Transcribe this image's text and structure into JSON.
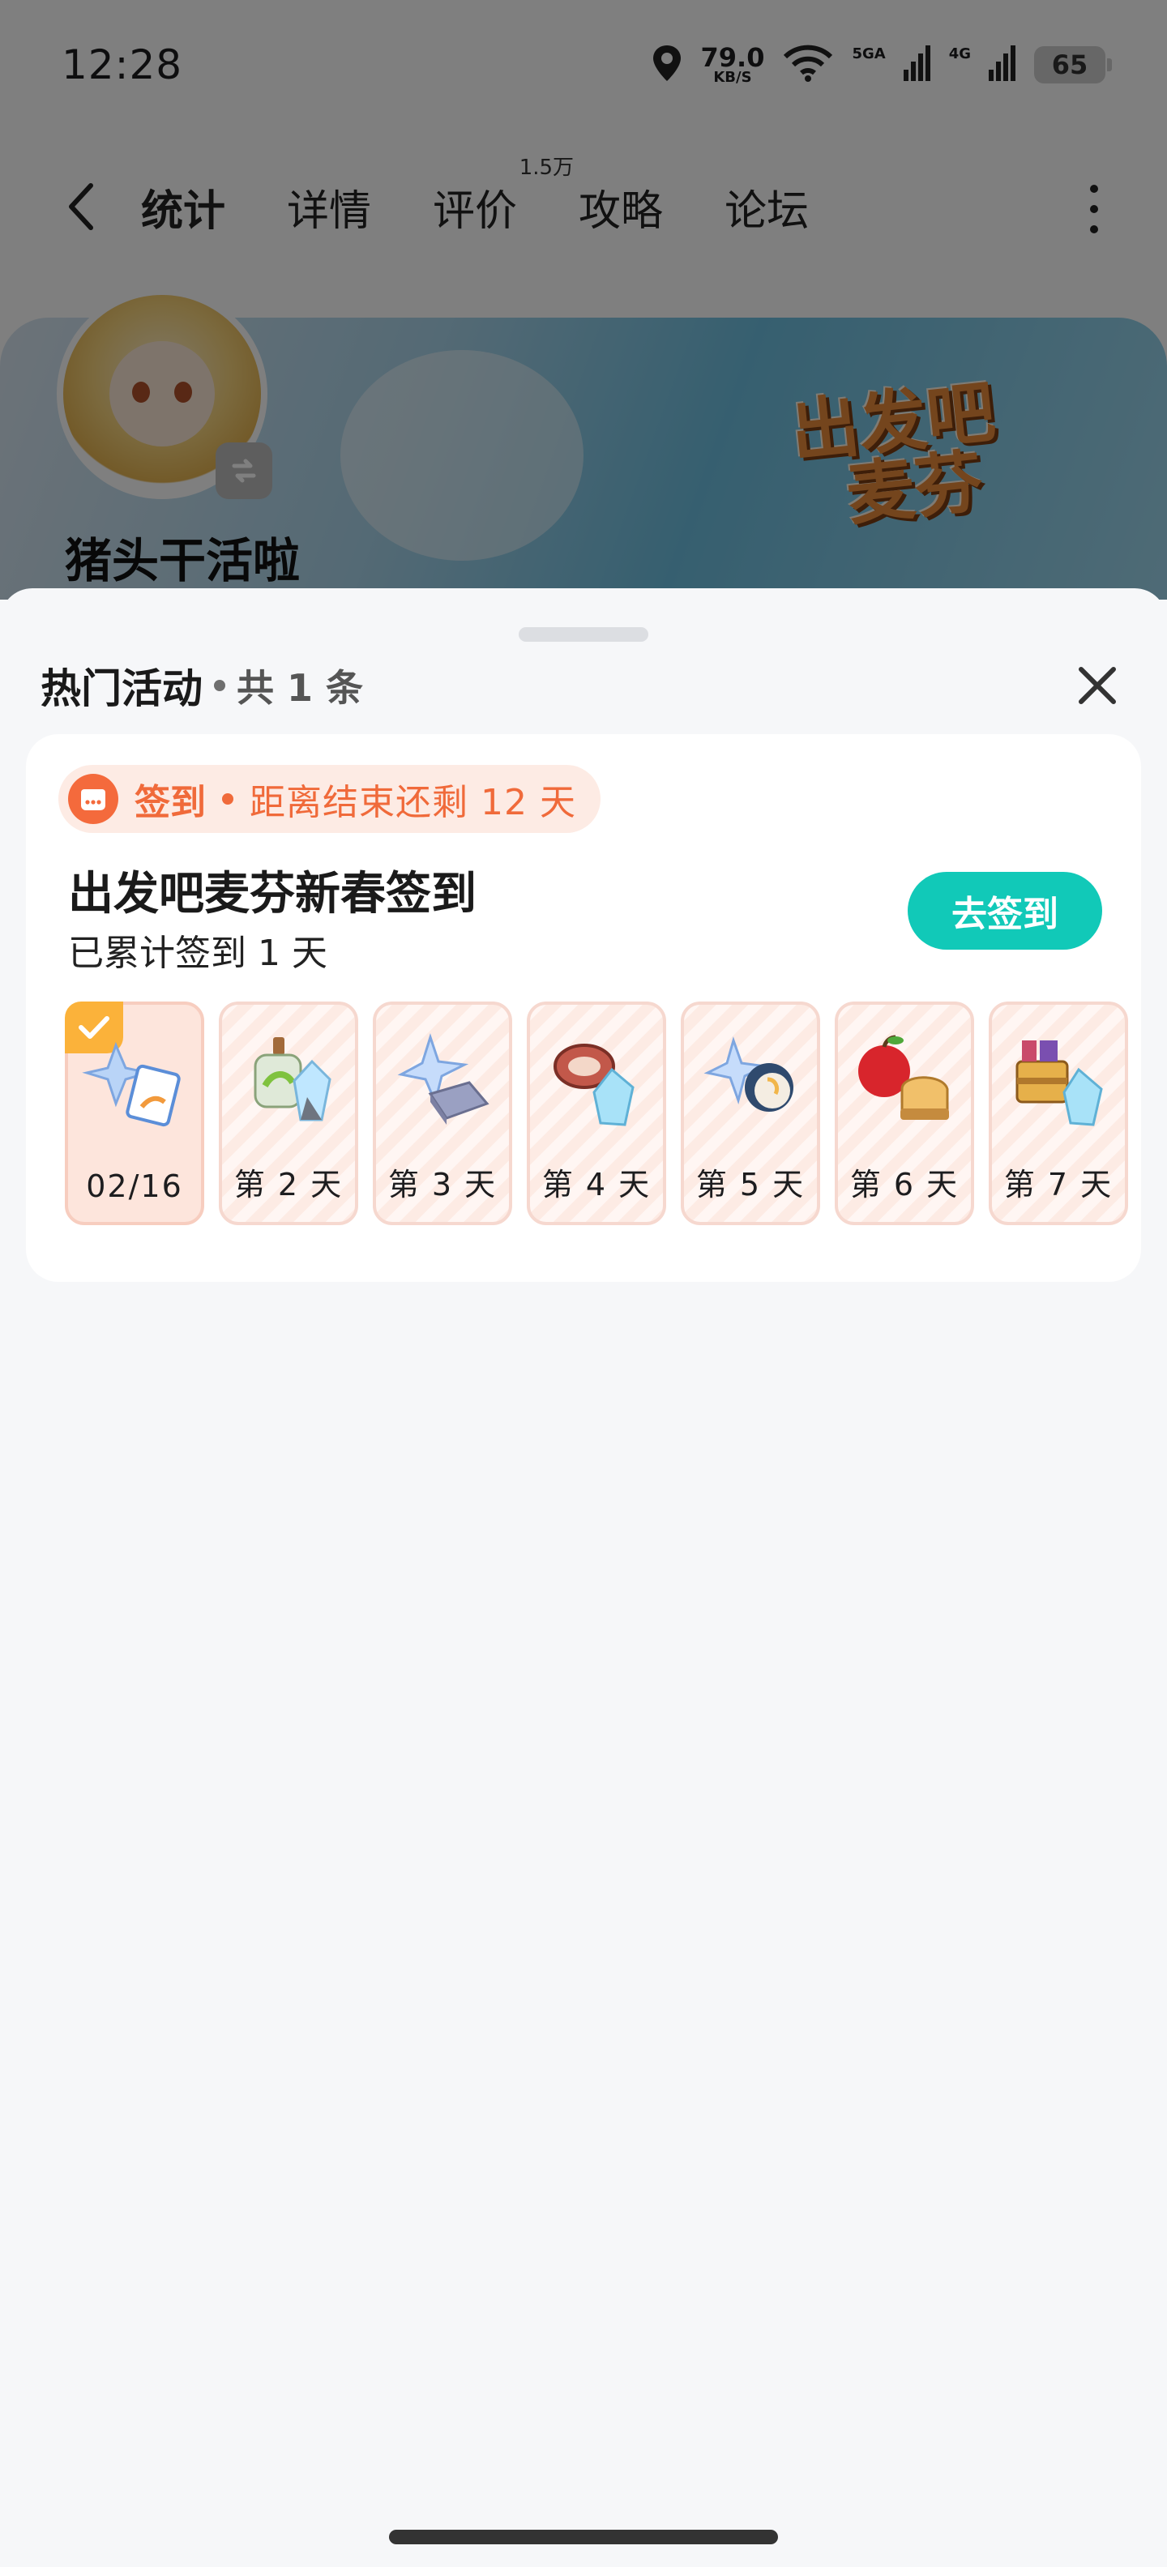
{
  "status_bar": {
    "time": "12:28",
    "net_speed": "79.0",
    "net_speed_unit": "KB/S",
    "signal1_label": "5GA",
    "signal2_label": "4G",
    "battery": "65"
  },
  "nav": {
    "tabs": [
      {
        "label": "统计",
        "active": true
      },
      {
        "label": "详情",
        "active": false
      },
      {
        "label": "评价",
        "active": false,
        "badge": "1.5万"
      },
      {
        "label": "攻略",
        "active": false
      },
      {
        "label": "论坛",
        "active": false
      }
    ],
    "accent": "#16c1b0"
  },
  "profile": {
    "nickname": "猪头干活啦",
    "banner_logo_line1": "出发吧",
    "banner_logo_line2": "麦芬"
  },
  "sheet": {
    "title": "热门活动",
    "count": "共 1 条",
    "activity": {
      "tag": "签到",
      "remaining": "距离结束还剩 12 天",
      "title": "出发吧麦芬新春签到",
      "progress": "已累计签到 1 天",
      "action": "去签到",
      "action_color": "#11c9b8",
      "tag_color": "#f06a3a",
      "days": [
        {
          "label": "02/16",
          "done": true,
          "reward_icons": [
            "crystal-icon",
            "coupon-icon"
          ]
        },
        {
          "label": "第 2 天",
          "done": false,
          "reward_icons": [
            "potion-icon",
            "crystal-icon"
          ]
        },
        {
          "label": "第 3 天",
          "done": false,
          "reward_icons": [
            "star-crystal-icon",
            "ingot-icon"
          ]
        },
        {
          "label": "第 4 天",
          "done": false,
          "reward_icons": [
            "meat-icon",
            "crystal-icon"
          ]
        },
        {
          "label": "第 5 天",
          "done": false,
          "reward_icons": [
            "star-crystal-icon",
            "egg-icon"
          ]
        },
        {
          "label": "第 6 天",
          "done": false,
          "reward_icons": [
            "apple-icon",
            "bread-icon"
          ]
        },
        {
          "label": "第 7 天",
          "done": false,
          "reward_icons": [
            "chest-icon",
            "crystal-icon"
          ]
        }
      ]
    }
  }
}
